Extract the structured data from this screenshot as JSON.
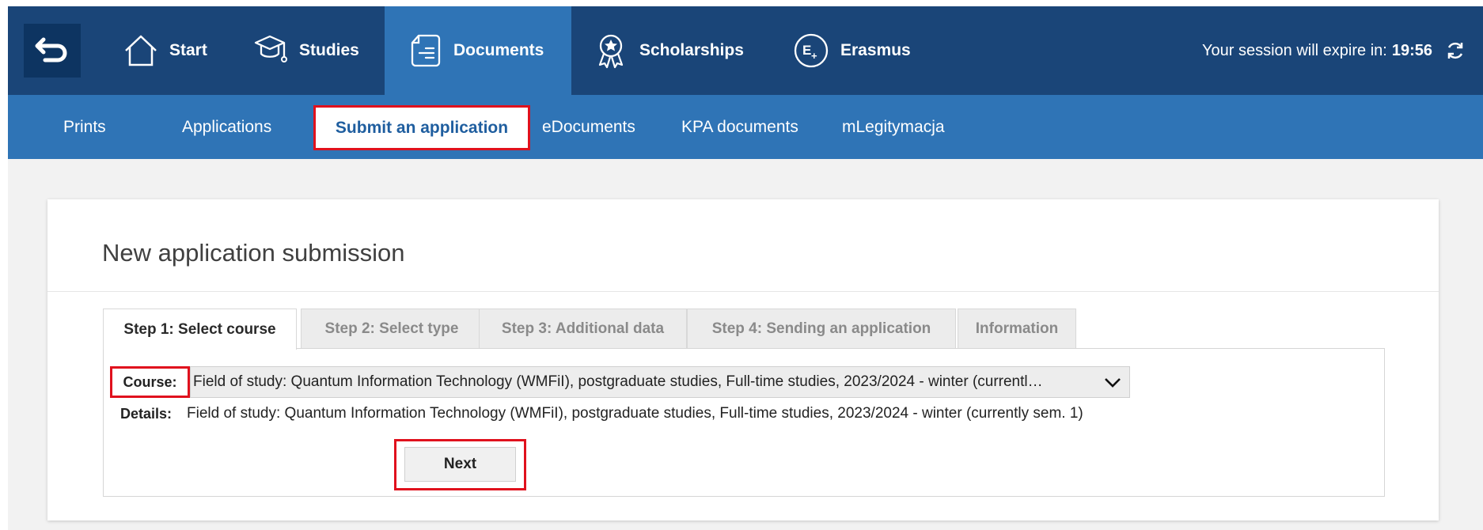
{
  "header": {
    "nav": [
      {
        "label": "Start",
        "icon": "home-icon"
      },
      {
        "label": "Studies",
        "icon": "graduation-cap-icon"
      },
      {
        "label": "Documents",
        "icon": "document-icon",
        "active": true
      },
      {
        "label": "Scholarships",
        "icon": "award-icon"
      },
      {
        "label": "Erasmus",
        "icon": "erasmus-icon"
      }
    ],
    "session_label": "Your session will expire in:",
    "session_time": "19:56"
  },
  "subnav": {
    "items": [
      "Prints",
      "Applications",
      "Submit an application",
      "eDocuments",
      "KPA documents",
      "mLegitymacja"
    ],
    "active_index": 2
  },
  "page": {
    "title": "New application submission",
    "tabs": [
      "Step 1: Select course",
      "Step 2: Select type",
      "Step 3: Additional data",
      "Step 4: Sending an application",
      "Information"
    ],
    "active_tab": 0,
    "course_label": "Course:",
    "course_value": "Field of study: Quantum Information Technology (WMFiI), postgraduate studies, Full-time studies, 2023/2024 - winter (currentl…",
    "details_label": "Details:",
    "details_value": "Field of study: Quantum Information Technology (WMFiI), postgraduate studies, Full-time studies, 2023/2024 - winter (currently sem. 1)",
    "next_label": "Next"
  },
  "colors": {
    "topbar": "#1a4578",
    "accent": "#2f74b6",
    "highlight": "#e0111d"
  }
}
